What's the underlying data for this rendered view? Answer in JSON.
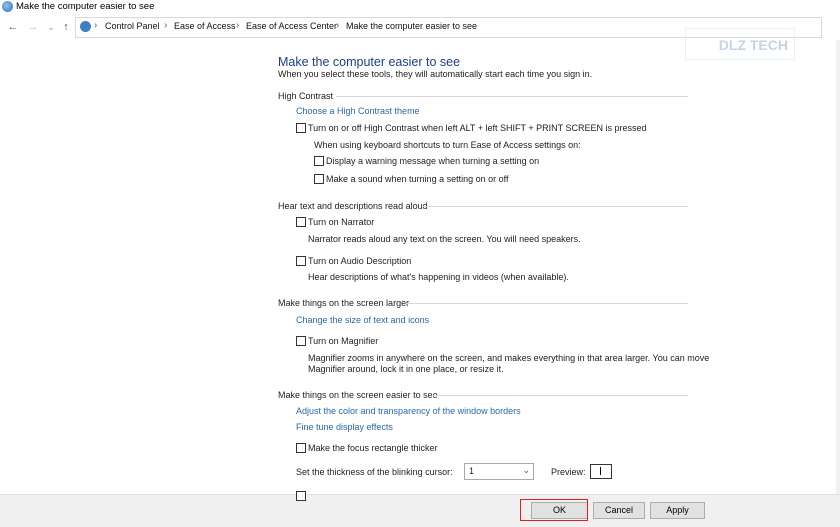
{
  "window": {
    "title": "Make the computer easier to see"
  },
  "nav": {
    "back": "←",
    "forward": "→",
    "recent": "⌄",
    "up": "↑",
    "breadcrumbs": [
      "Control Panel",
      "Ease of Access",
      "Ease of Access Center",
      "Make the computer easier to see"
    ],
    "separator": "›"
  },
  "watermark": "DLZ TECH",
  "page": {
    "title": "Make the computer easier to see",
    "subtitle": "When you select these tools, they will automatically start each time you sign in."
  },
  "high_contrast": {
    "heading": "High Contrast",
    "link": "Choose a High Contrast theme",
    "toggle_label": "Turn on or off High Contrast when left ALT + left SHIFT + PRINT SCREEN is pressed",
    "shortcuts_note": "When using keyboard shortcuts to turn Ease of Access settings on:",
    "warning_label": "Display a warning message when turning a setting on",
    "sound_label": "Make a sound when turning a setting on or off"
  },
  "narration": {
    "heading": "Hear text and descriptions read aloud",
    "narrator_label": "Turn on Narrator",
    "narrator_desc": "Narrator reads aloud any text on the screen. You will need speakers.",
    "audio_desc_label": "Turn on Audio Description",
    "audio_desc_desc": "Hear descriptions of what's happening in videos (when available)."
  },
  "larger": {
    "heading": "Make things on the screen larger",
    "link": "Change the size of text and icons",
    "magnifier_label": "Turn on Magnifier",
    "magnifier_desc_1": "Magnifier zooms in anywhere on the screen, and makes everything in that area larger. You can move",
    "magnifier_desc_2": "Magnifier around, lock it in one place, or resize it."
  },
  "easier": {
    "heading": "Make things on the screen easier to see",
    "link_borders": "Adjust the color and transparency of the window borders",
    "link_effects": "Fine tune display effects",
    "focus_label": "Make the focus rectangle thicker",
    "cursor_label": "Set the thickness of the blinking cursor:",
    "cursor_value": "1",
    "preview_label": "Preview:"
  },
  "buttons": {
    "ok": "OK",
    "cancel": "Cancel",
    "apply": "Apply"
  },
  "colors": {
    "accent_link": "#2867b2",
    "title_blue": "#1a3e8c",
    "highlight": "#e02020"
  }
}
